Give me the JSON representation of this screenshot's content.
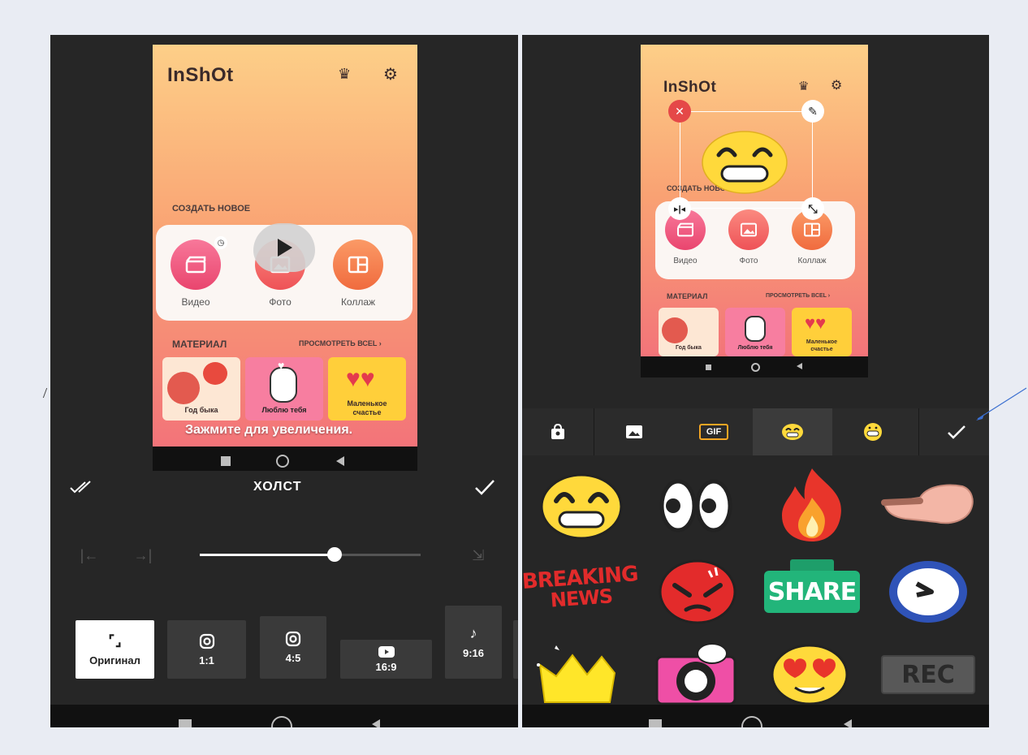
{
  "left": {
    "app": {
      "logo": "InShOt",
      "create_title": "СОЗДАТЬ НОВОЕ",
      "buttons": [
        {
          "label": "Видео",
          "icon": "clapper-icon"
        },
        {
          "label": "Фото",
          "icon": "image-icon"
        },
        {
          "label": "Коллаж",
          "icon": "collage-icon"
        }
      ],
      "material_title": "МАТЕРИАЛ",
      "see_all": "ПРОСМОТРЕТЬ ВСЕL",
      "materials": [
        "Год быка",
        "Люблю тебя",
        "Маленькое счастье"
      ],
      "hint": "Зажмите для увеличения."
    },
    "editor": {
      "title": "ХОЛСТ",
      "slider_value": 0.61,
      "ratios": [
        {
          "label": "Оригинал",
          "icon": "expand-icon",
          "active": true
        },
        {
          "label": "1:1",
          "icon": "instagram-icon",
          "active": false
        },
        {
          "label": "4:5",
          "icon": "instagram-icon",
          "active": false
        },
        {
          "label": "16:9",
          "icon": "youtube-icon",
          "active": false
        },
        {
          "label": "9:16",
          "icon": "tiktok-icon",
          "active": false
        }
      ]
    }
  },
  "right": {
    "app": {
      "logo": "InShOt",
      "create_title": "СОЗДАТЬ НОВОЕ",
      "buttons": [
        {
          "label": "Видео"
        },
        {
          "label": "Фото"
        },
        {
          "label": "Коллаж"
        }
      ],
      "material_title": "МАТЕРИАЛ",
      "see_all": "ПРОСМОТРЕТЬ ВСЕL",
      "materials": [
        "Год быка",
        "Люблю тебя",
        "Маленькое счастье"
      ]
    },
    "sticker_tabs": [
      {
        "icon": "shopping-bag-icon",
        "active": false
      },
      {
        "icon": "image-icon",
        "active": false
      },
      {
        "label": "GIF",
        "icon": "gif-icon",
        "active": false
      },
      {
        "icon": "grin-emoji-icon",
        "active": true
      },
      {
        "icon": "grimace-emoji-icon",
        "active": false
      },
      {
        "icon": "check-icon",
        "active": false
      }
    ],
    "stickers": {
      "breaking_line1": "BREAKING",
      "breaking_line2": "NEWS",
      "share": "SHARE",
      "rec": "REC"
    }
  },
  "colors": {
    "accent_pink": "#ee4b6c",
    "panel_bg": "#262626",
    "emoji_yellow": "#ffd93b",
    "annotation_arrow": "#3b6fd0"
  }
}
